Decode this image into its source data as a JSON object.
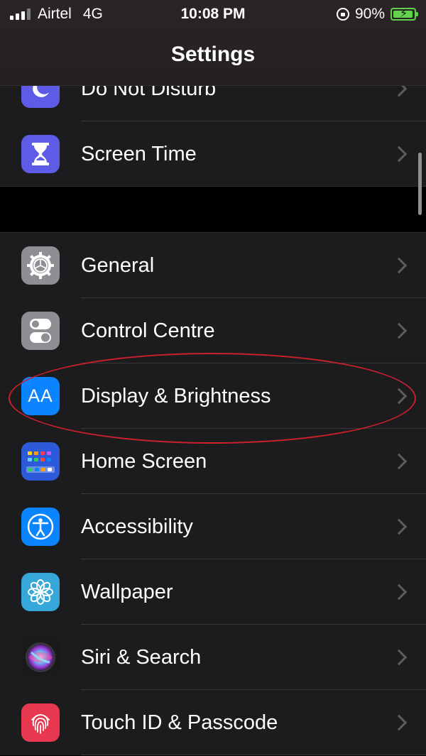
{
  "status_bar": {
    "carrier": "Airtel",
    "network": "4G",
    "time": "10:08 PM",
    "battery_percent": "90%",
    "icons": [
      "signal-icon",
      "rotation-lock-icon",
      "battery-charging-icon"
    ]
  },
  "nav": {
    "title": "Settings"
  },
  "colors": {
    "background": "#000000",
    "cell": "#1c1c1e",
    "separator": "#38383a",
    "highlight_circle": "#c9202c",
    "battery": "#62d34a"
  },
  "group1": {
    "items": [
      {
        "label": "Do Not Disturb",
        "icon": "moon-icon",
        "color": "#5e5ce6"
      },
      {
        "label": "Screen Time",
        "icon": "hourglass-icon",
        "color": "#5e5ce6"
      }
    ]
  },
  "group2": {
    "items": [
      {
        "label": "General",
        "icon": "gear-icon",
        "color": "#8e8e93"
      },
      {
        "label": "Control Centre",
        "icon": "toggles-icon",
        "color": "#8e8e93"
      },
      {
        "label": "Display & Brightness",
        "icon": "text-size-aa-icon",
        "color": "#0a84ff"
      },
      {
        "label": "Home Screen",
        "icon": "app-grid-icon",
        "color": "#2c5ad8"
      },
      {
        "label": "Accessibility",
        "icon": "accessibility-person-icon",
        "color": "#0a84ff"
      },
      {
        "label": "Wallpaper",
        "icon": "flower-icon",
        "color": "#36a7d9"
      },
      {
        "label": "Siri & Search",
        "icon": "siri-icon",
        "color": "#1a1a1a"
      },
      {
        "label": "Touch ID & Passcode",
        "icon": "fingerprint-icon",
        "color": "#e8384f"
      }
    ]
  },
  "display_icon_text": "AA"
}
